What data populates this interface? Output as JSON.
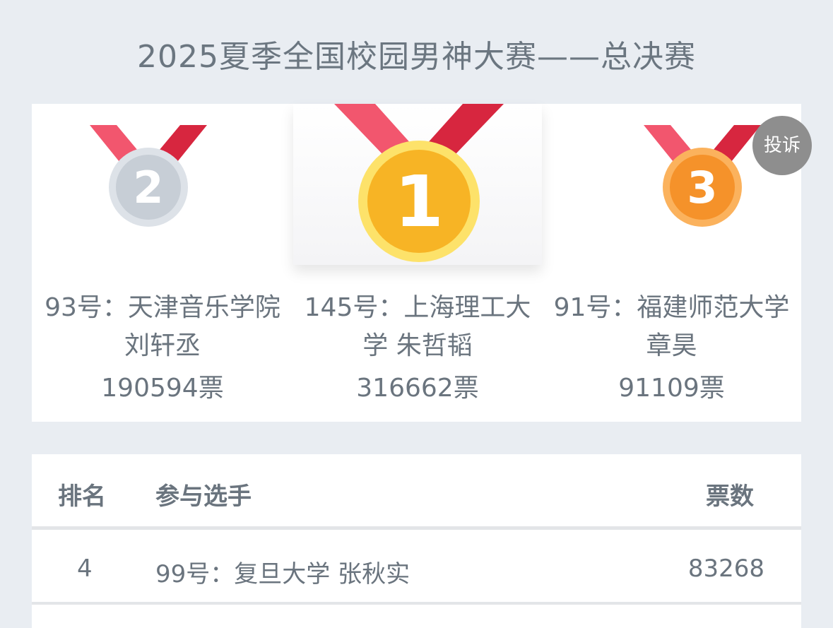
{
  "page": {
    "title": "2025夏季全国校园男神大赛——总决赛"
  },
  "podium": [
    {
      "rank": "2",
      "name": "93号：天津音乐学院 刘轩丞",
      "votes": "190594票",
      "medal_color": "#c7ced6"
    },
    {
      "rank": "1",
      "name": "145号：上海理工大学 朱哲韬",
      "votes": "316662票",
      "medal_color": "#f7b425"
    },
    {
      "rank": "3",
      "name": "91号：福建师范大学 章昊",
      "votes": "91109票",
      "medal_color": "#f5922a"
    }
  ],
  "complain": {
    "label": "投诉"
  },
  "table": {
    "headers": {
      "rank": "排名",
      "player": "参与选手",
      "votes": "票数"
    },
    "rows": [
      {
        "rank": "4",
        "player": "99号：复旦大学 张秋实",
        "votes": "83268"
      }
    ]
  },
  "colors": {
    "ribbon_light": "#f2566e",
    "ribbon_dark": "#d7263f",
    "page_bg": "#e9edf2",
    "text": "#6a747e"
  }
}
